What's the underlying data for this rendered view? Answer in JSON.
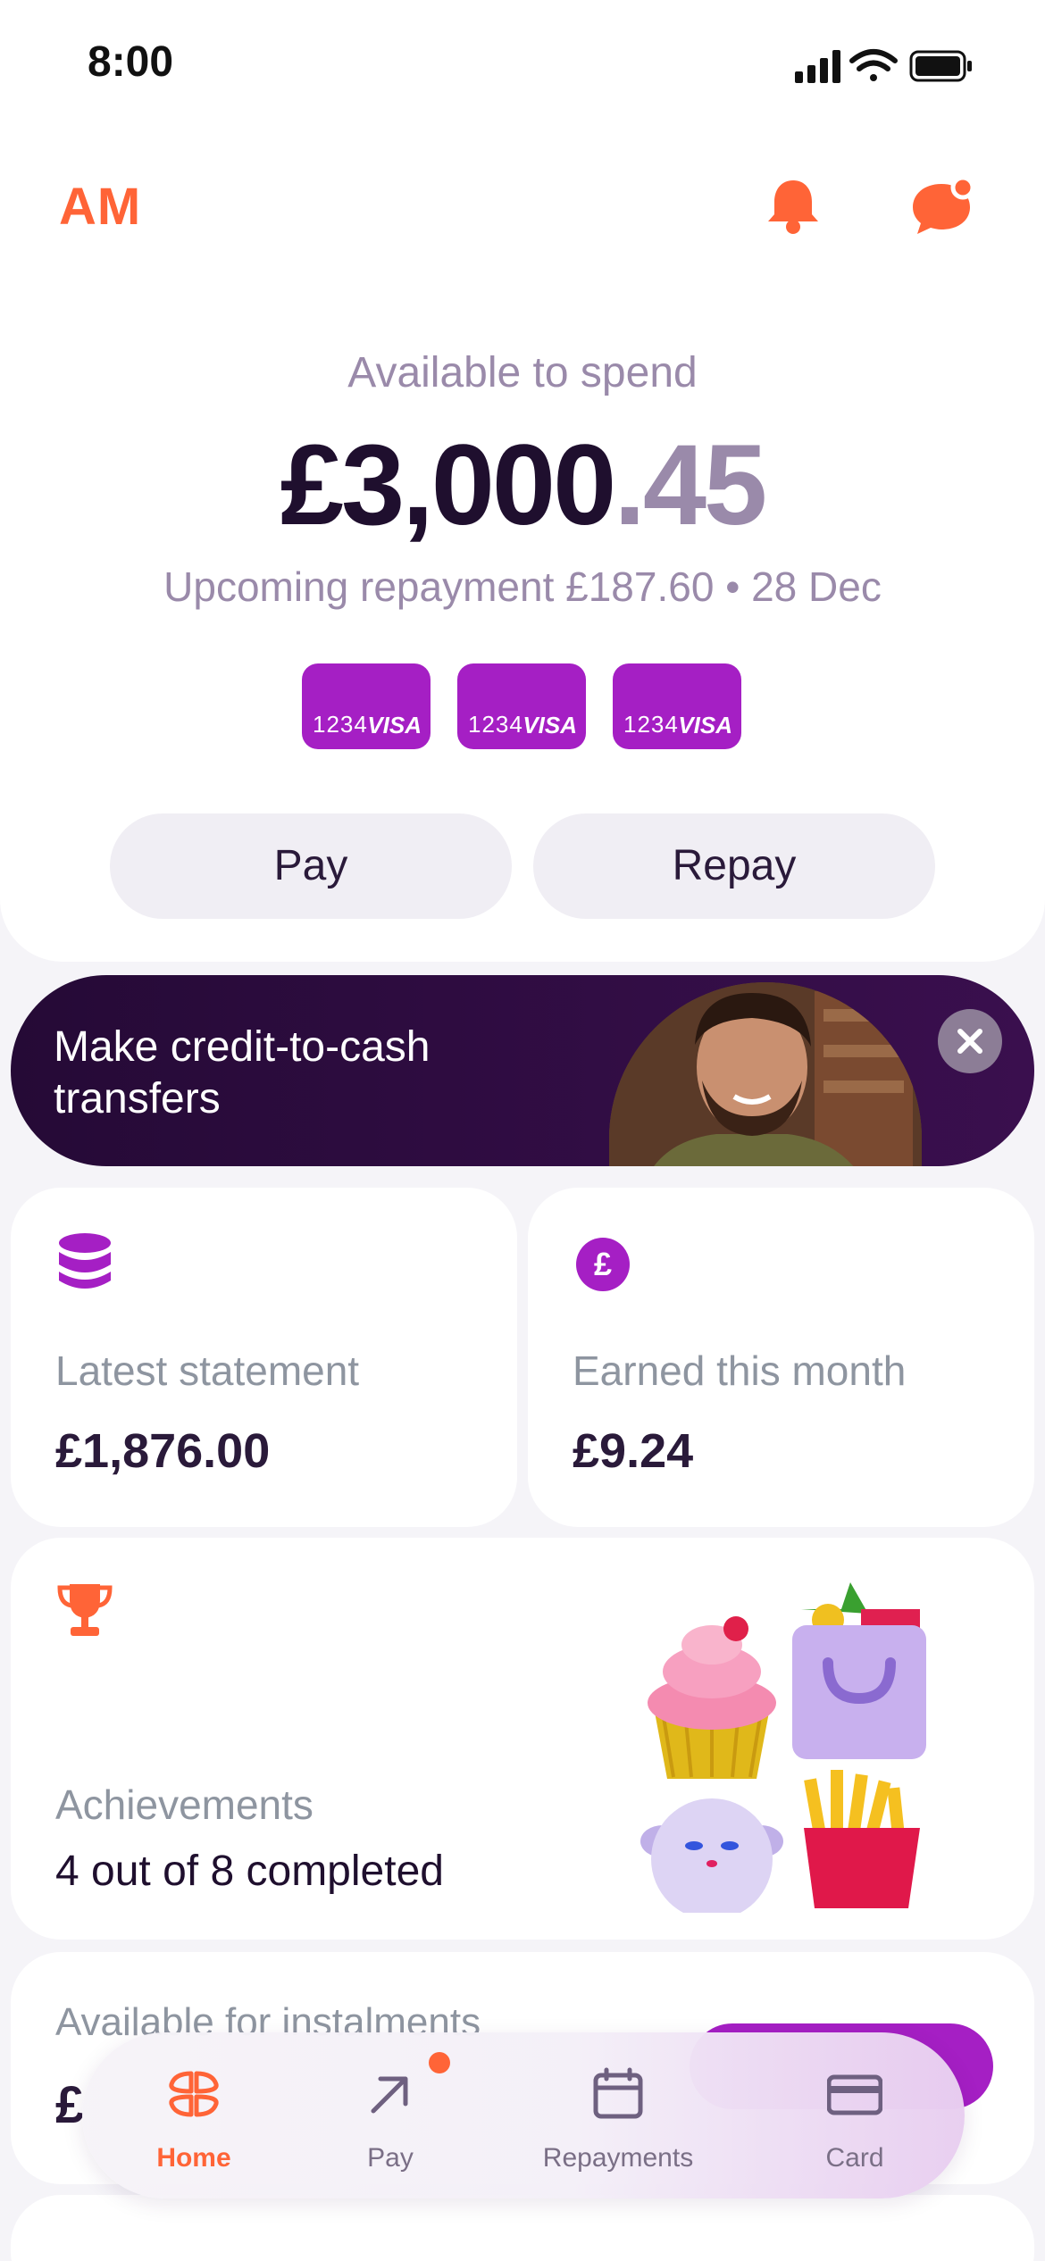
{
  "status_bar": {
    "time": "8:00"
  },
  "header": {
    "initials": "AM"
  },
  "balance": {
    "label": "Available to spend",
    "whole": "£3,000",
    "decimal": ".45",
    "upcoming": "Upcoming repayment £187.60 • 28 Dec"
  },
  "cards": [
    {
      "number": "1234",
      "brand": "VISA"
    },
    {
      "number": "1234",
      "brand": "VISA"
    },
    {
      "number": "1234",
      "brand": "VISA"
    }
  ],
  "actions": {
    "pay_label": "Pay",
    "repay_label": "Repay"
  },
  "promo": {
    "text": "Make credit-to-cash transfers"
  },
  "tiles": {
    "statement": {
      "label": "Latest statement",
      "value": "£1,876.00"
    },
    "earned": {
      "icon_glyph": "£",
      "label": "Earned this month",
      "value": "£9.24"
    },
    "achievements": {
      "label": "Achievements",
      "value": "4 out of 8 completed"
    },
    "instalments": {
      "label": "Available for instalments",
      "value": "£"
    }
  },
  "tabbar": {
    "items": [
      {
        "label": "Home",
        "icon": "home-icon",
        "active": true
      },
      {
        "label": "Pay",
        "icon": "arrow-up-right-icon",
        "badge": true
      },
      {
        "label": "Repayments",
        "icon": "calendar-icon"
      },
      {
        "label": "Card",
        "icon": "card-icon"
      }
    ]
  },
  "colors": {
    "accent": "#ff6437",
    "purple": "#a51fc4",
    "dark": "#1f0f2e",
    "muted": "#9a8aaa"
  }
}
